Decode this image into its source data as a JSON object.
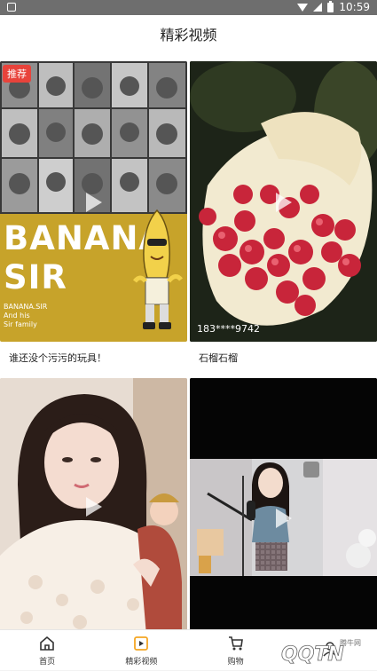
{
  "status_bar": {
    "time": "10:59"
  },
  "header": {
    "title": "精彩视频"
  },
  "cards": [
    {
      "tag": "推荐",
      "caption": "谁还没个污污的玩具！",
      "poster_title_1": "BANANA",
      "poster_title_2": "SIR",
      "poster_sub_1": "BANANA.SIR",
      "poster_sub_2": "And his",
      "poster_sub_3": "Sir family"
    },
    {
      "user": "183****9742",
      "caption": "石榴石榴"
    },
    {},
    {}
  ],
  "tabs": [
    {
      "label": "首页",
      "icon": "home-icon"
    },
    {
      "label": "精彩视频",
      "icon": "video-icon"
    },
    {
      "label": "购物",
      "icon": "cart-icon"
    },
    {
      "label": "",
      "icon": "profile-icon"
    }
  ],
  "watermark": {
    "text": "QQTN",
    "sub": "腾牛网"
  },
  "colors": {
    "tag_bg": "#e8433b",
    "active_tab": "#f5a623",
    "poster_yellow": "#c7a32a"
  }
}
